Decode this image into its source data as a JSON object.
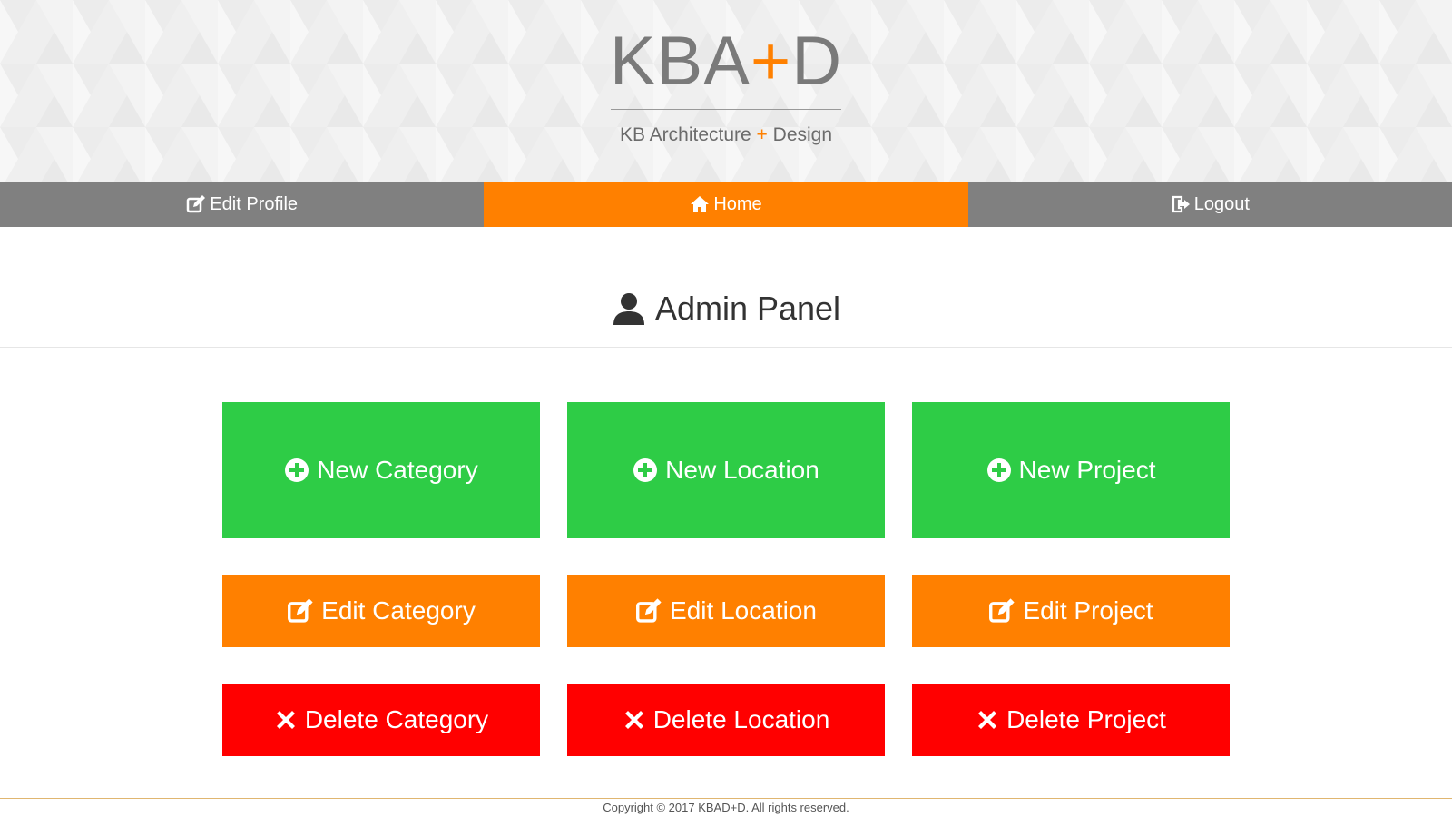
{
  "header": {
    "logo_left": "KBA",
    "logo_plus": "+",
    "logo_right": "D",
    "tagline_left": "KB Architecture",
    "tagline_plus": "+",
    "tagline_right": "Design"
  },
  "nav": {
    "items": [
      {
        "label": "Edit Profile",
        "icon": "edit-icon"
      },
      {
        "label": "Home",
        "icon": "home-icon",
        "active": true
      },
      {
        "label": "Logout",
        "icon": "logout-icon"
      }
    ]
  },
  "panel": {
    "title": "Admin Panel",
    "icon": "user-icon"
  },
  "actions": {
    "create": [
      {
        "label": "New Category",
        "icon": "plus-circle-icon"
      },
      {
        "label": "New Location",
        "icon": "plus-circle-icon"
      },
      {
        "label": "New Project",
        "icon": "plus-circle-icon"
      }
    ],
    "edit": [
      {
        "label": "Edit Category",
        "icon": "edit-icon"
      },
      {
        "label": "Edit Location",
        "icon": "edit-icon"
      },
      {
        "label": "Edit Project",
        "icon": "edit-icon"
      }
    ],
    "delete": [
      {
        "label": "Delete Category",
        "icon": "close-icon"
      },
      {
        "label": "Delete Location",
        "icon": "close-icon"
      },
      {
        "label": "Delete Project",
        "icon": "close-icon"
      }
    ]
  },
  "footer": {
    "copyright": "Copyright © 2017 KBAD+D. All rights reserved."
  },
  "colors": {
    "accent": "#ff8000",
    "nav_gray": "#808080",
    "create_green": "#2ecc46",
    "delete_red": "#ff0000"
  }
}
